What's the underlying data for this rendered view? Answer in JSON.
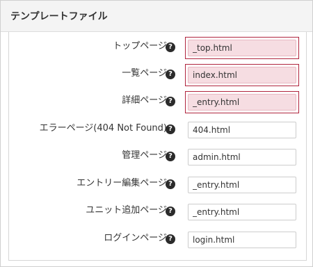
{
  "panel": {
    "title": "テンプレートファイル"
  },
  "help_icon_glyph": "?",
  "rows": [
    {
      "label": "トップページ",
      "value": "_top.html",
      "error": true
    },
    {
      "label": "一覧ページ",
      "value": "index.html",
      "error": true
    },
    {
      "label": "詳細ページ",
      "value": "_entry.html",
      "error": true
    },
    {
      "label": "エラーページ(404 Not Found)",
      "value": "404.html",
      "error": false
    },
    {
      "label": "管理ページ",
      "value": "admin.html",
      "error": false
    },
    {
      "label": "エントリー編集ページ",
      "value": "_entry.html",
      "error": false
    },
    {
      "label": "ユニット追加ページ",
      "value": "_entry.html",
      "error": false
    },
    {
      "label": "ログインページ",
      "value": "login.html",
      "error": false
    }
  ],
  "colors": {
    "error_border": "#b0243d",
    "error_fill": "#f6dde2",
    "help_icon": "#2b2b2b"
  }
}
